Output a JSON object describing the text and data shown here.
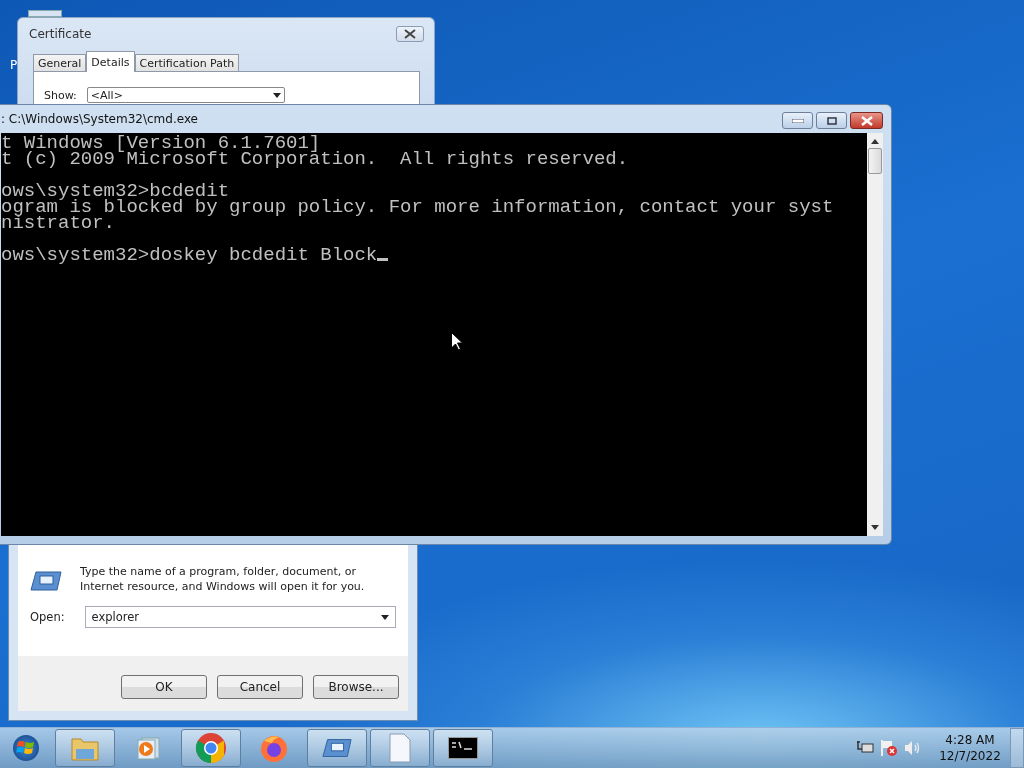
{
  "desktop": {
    "icon_label": "P"
  },
  "certificate": {
    "title": "Certificate",
    "tabs": [
      {
        "label": "General",
        "selected": false
      },
      {
        "label": "Details",
        "selected": true
      },
      {
        "label": "Certification Path",
        "selected": false
      }
    ],
    "show_label": "Show:",
    "show_value": "<All>"
  },
  "run_dialog": {
    "description": "Type the name of a program, folder, document, or Internet resource, and Windows will open it for you.",
    "open_label": "Open:",
    "open_value": "explorer",
    "buttons": [
      "OK",
      "Cancel",
      "Browse..."
    ]
  },
  "cmd": {
    "title": ": C:\\Windows\\System32\\cmd.exe",
    "blocks": [
      [
        "t Windows [Version 6.1.7601]",
        "t (c) 2009 Microsoft Corporation.  All rights reserved."
      ],
      [
        "ows\\system32>bcdedit",
        "ogram is blocked by group policy. For more information, contact your syst",
        "nistrator."
      ],
      [
        "ows\\system32>doskey bcdedit Block"
      ]
    ]
  },
  "taskbar": {
    "items": [
      {
        "kind": "folder",
        "running": true
      },
      {
        "kind": "media",
        "running": false
      },
      {
        "kind": "chrome",
        "running": true
      },
      {
        "kind": "firefox",
        "running": false
      },
      {
        "kind": "run",
        "running": true
      },
      {
        "kind": "document",
        "running": true
      },
      {
        "kind": "console",
        "running": true
      }
    ],
    "clock": {
      "time": "4:28 AM",
      "date": "12/7/2022"
    }
  }
}
